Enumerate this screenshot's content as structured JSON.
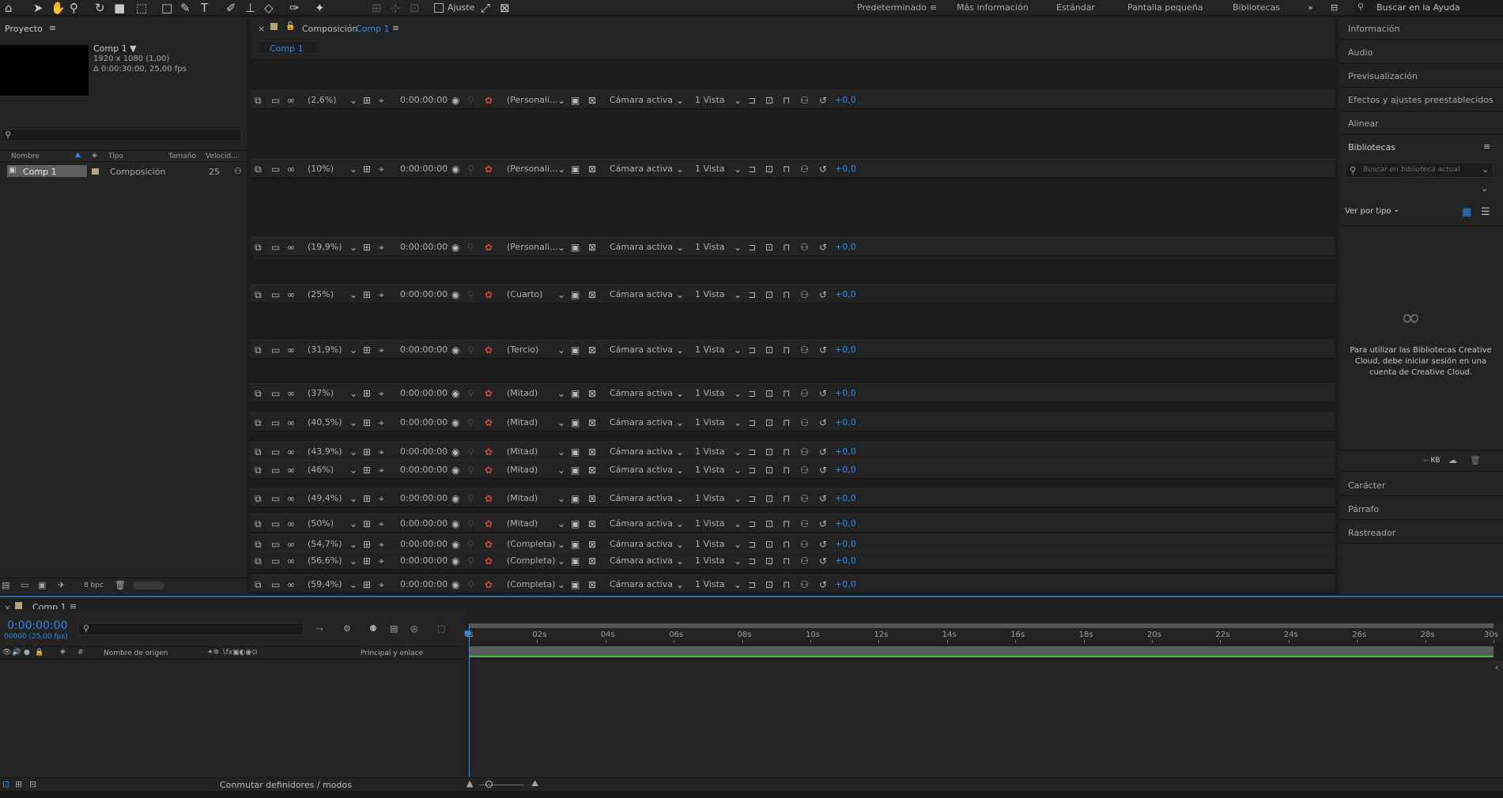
{
  "toolbar": {
    "snap_label": "Ajuste",
    "workspaces": [
      "Predeterminado",
      "Más información",
      "Estándar",
      "Pantalla pequeña",
      "Bibliotecas"
    ],
    "help_search_placeholder": "Buscar en la Ayuda"
  },
  "project": {
    "title": "Proyecto",
    "comp_name": "Comp 1 ▼",
    "comp_size": "1920 x 1080 (1,00)",
    "comp_duration": "Δ 0:00:30:00, 25,00 fps",
    "columns": [
      "Nombre",
      "Tipo",
      "Tamaño",
      "Velocid..."
    ],
    "rows": [
      {
        "name": "Comp 1",
        "type": "Composición",
        "fps": "25"
      }
    ],
    "bpc": "8 bpc"
  },
  "viewer": {
    "panel_prefix": "Composición",
    "panel_comp": "Comp 1",
    "tab": "Comp 1",
    "timecode": "0:00:00:00",
    "camera": "Cámara activa",
    "views": "1 Vista",
    "exposure": "+0,0",
    "rows": [
      {
        "zoom": "(2,6%)",
        "res": "(Personali..."
      },
      {
        "zoom": "(10%)",
        "res": "(Personali..."
      },
      {
        "zoom": "(19,9%)",
        "res": "(Personali..."
      },
      {
        "zoom": "(25%)",
        "res": "(Cuarto)"
      },
      {
        "zoom": "(31,9%)",
        "res": "(Tercio)"
      },
      {
        "zoom": "(37%)",
        "res": "(Mitad)"
      },
      {
        "zoom": "(40,5%)",
        "res": "(Mitad)"
      },
      {
        "zoom": "(43,9%)",
        "res": "(Mitad)"
      },
      {
        "zoom": "(46%)",
        "res": "(Mitad)"
      },
      {
        "zoom": "(49,4%)",
        "res": "(Mitad)"
      },
      {
        "zoom": "(50%)",
        "res": "(Mitad)"
      },
      {
        "zoom": "(54,7%)",
        "res": "(Completa)"
      },
      {
        "zoom": "(56,6%)",
        "res": "(Completa)"
      },
      {
        "zoom": "(59,4%)",
        "res": "(Completa)"
      }
    ]
  },
  "right_panel": {
    "items_top": [
      "Información",
      "Audio",
      "Previsualización",
      "Efectos y ajustes preestablecidos",
      "Alinear"
    ],
    "libraries_title": "Bibliotecas",
    "libraries_search_placeholder": "Buscar en biblioteca actual",
    "view_by": "Ver por tipo",
    "cc_message": "Para utilizar las Bibliotecas Creative Cloud, debe iniciar sesión en una cuenta de Creative Cloud.",
    "kb": "-- KB",
    "items_bottom": [
      "Carácter",
      "Párrafo",
      "Rastreador"
    ]
  },
  "timeline": {
    "tab": "Comp 1",
    "timecode": "0:00:00:00",
    "frames": "00000 (25,00 fps)",
    "col_source": "Nombre de origen",
    "col_parent": "Principal y enlace",
    "ticks": [
      "0s",
      "02s",
      "04s",
      "06s",
      "08s",
      "10s",
      "12s",
      "14s",
      "16s",
      "18s",
      "20s",
      "22s",
      "24s",
      "26s",
      "28s",
      "30s"
    ],
    "footer_toggle": "Conmutar definidores / modos"
  }
}
